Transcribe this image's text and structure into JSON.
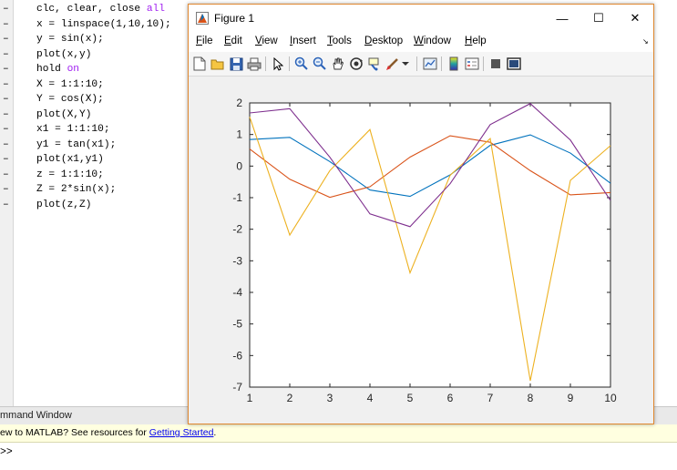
{
  "editor": {
    "lines": [
      {
        "pre": "clc, clear, close ",
        "kw": "all",
        "post": ""
      },
      {
        "pre": "x = linspace(1,10,10);",
        "kw": "",
        "post": ""
      },
      {
        "pre": "y = sin(x);",
        "kw": "",
        "post": ""
      },
      {
        "pre": "plot(x,y)",
        "kw": "",
        "post": ""
      },
      {
        "pre": "hold ",
        "kw": "on",
        "post": ""
      },
      {
        "pre": "X = 1:1:10;",
        "kw": "",
        "post": ""
      },
      {
        "pre": "Y = cos(X);",
        "kw": "",
        "post": ""
      },
      {
        "pre": "plot(X,Y)",
        "kw": "",
        "post": ""
      },
      {
        "pre": "x1 = 1:1:10;",
        "kw": "",
        "post": ""
      },
      {
        "pre": "y1 = tan(x1);",
        "kw": "",
        "post": ""
      },
      {
        "pre": "plot(x1,y1)",
        "kw": "",
        "post": ""
      },
      {
        "pre": "z = 1:1:10;",
        "kw": "",
        "post": ""
      },
      {
        "pre": "Z = 2*sin(x);",
        "kw": "",
        "post": ""
      },
      {
        "pre": "plot(z,Z)",
        "kw": "",
        "post": ""
      }
    ],
    "dash": "–"
  },
  "command_window": {
    "title": "mmand Window",
    "banner_text": "ew to MATLAB? See resources for ",
    "banner_link": "Getting Started",
    "banner_end": ".",
    "prompt": ">>"
  },
  "figure": {
    "title": "Figure 1",
    "min_glyph": "—",
    "max_glyph": "☐",
    "close_glyph": "✕",
    "menus": [
      {
        "label": "File",
        "ul": "F",
        "rest": "ile"
      },
      {
        "label": "Edit",
        "ul": "E",
        "rest": "dit"
      },
      {
        "label": "View",
        "ul": "V",
        "rest": "iew"
      },
      {
        "label": "Insert",
        "ul": "I",
        "rest": "nsert"
      },
      {
        "label": "Tools",
        "ul": "T",
        "rest": "ools"
      },
      {
        "label": "Desktop",
        "ul": "D",
        "rest": "esktop"
      },
      {
        "label": "Window",
        "ul": "W",
        "rest": "indow"
      },
      {
        "label": "Help",
        "ul": "H",
        "rest": "elp"
      }
    ],
    "menu_more": "↘",
    "toolbar": [
      "new-figure-icon",
      "open-file-icon",
      "save-icon",
      "print-icon",
      "pointer-icon",
      "zoom-in-icon",
      "zoom-out-icon",
      "pan-hand-icon",
      "rotate-3d-icon",
      "data-cursor-icon",
      "brush-icon",
      "brush-dropdown-icon",
      "link-plot-icon",
      "colorbar-icon",
      "legend-icon",
      "hide-plot-tools-icon",
      "show-plot-tools-icon"
    ]
  },
  "chart_data": {
    "type": "line",
    "title": "",
    "xlabel": "",
    "ylabel": "",
    "xlim": [
      1,
      10
    ],
    "ylim": [
      -7,
      2
    ],
    "xticks": [
      1,
      2,
      3,
      4,
      5,
      6,
      7,
      8,
      9,
      10
    ],
    "yticks": [
      2,
      1,
      0,
      -1,
      -2,
      -3,
      -4,
      -5,
      -6,
      -7
    ],
    "x": [
      1,
      2,
      3,
      4,
      5,
      6,
      7,
      8,
      9,
      10
    ],
    "series": [
      {
        "color": "#0072bd",
        "values": [
          0.841,
          0.909,
          0.141,
          -0.757,
          -0.959,
          -0.279,
          0.657,
          0.989,
          0.412,
          -0.544
        ]
      },
      {
        "color": "#d95319",
        "values": [
          0.54,
          -0.416,
          -0.99,
          -0.654,
          0.284,
          0.96,
          0.754,
          -0.146,
          -0.911,
          -0.839
        ]
      },
      {
        "color": "#edb120",
        "values": [
          1.557,
          -2.185,
          -0.143,
          1.158,
          -3.381,
          -0.291,
          0.871,
          -6.8,
          -0.452,
          0.648
        ]
      },
      {
        "color": "#7e2f8e",
        "values": [
          1.683,
          1.819,
          0.282,
          -1.514,
          -1.918,
          -0.559,
          1.314,
          1.979,
          0.824,
          -1.088
        ]
      }
    ],
    "grid": false
  }
}
